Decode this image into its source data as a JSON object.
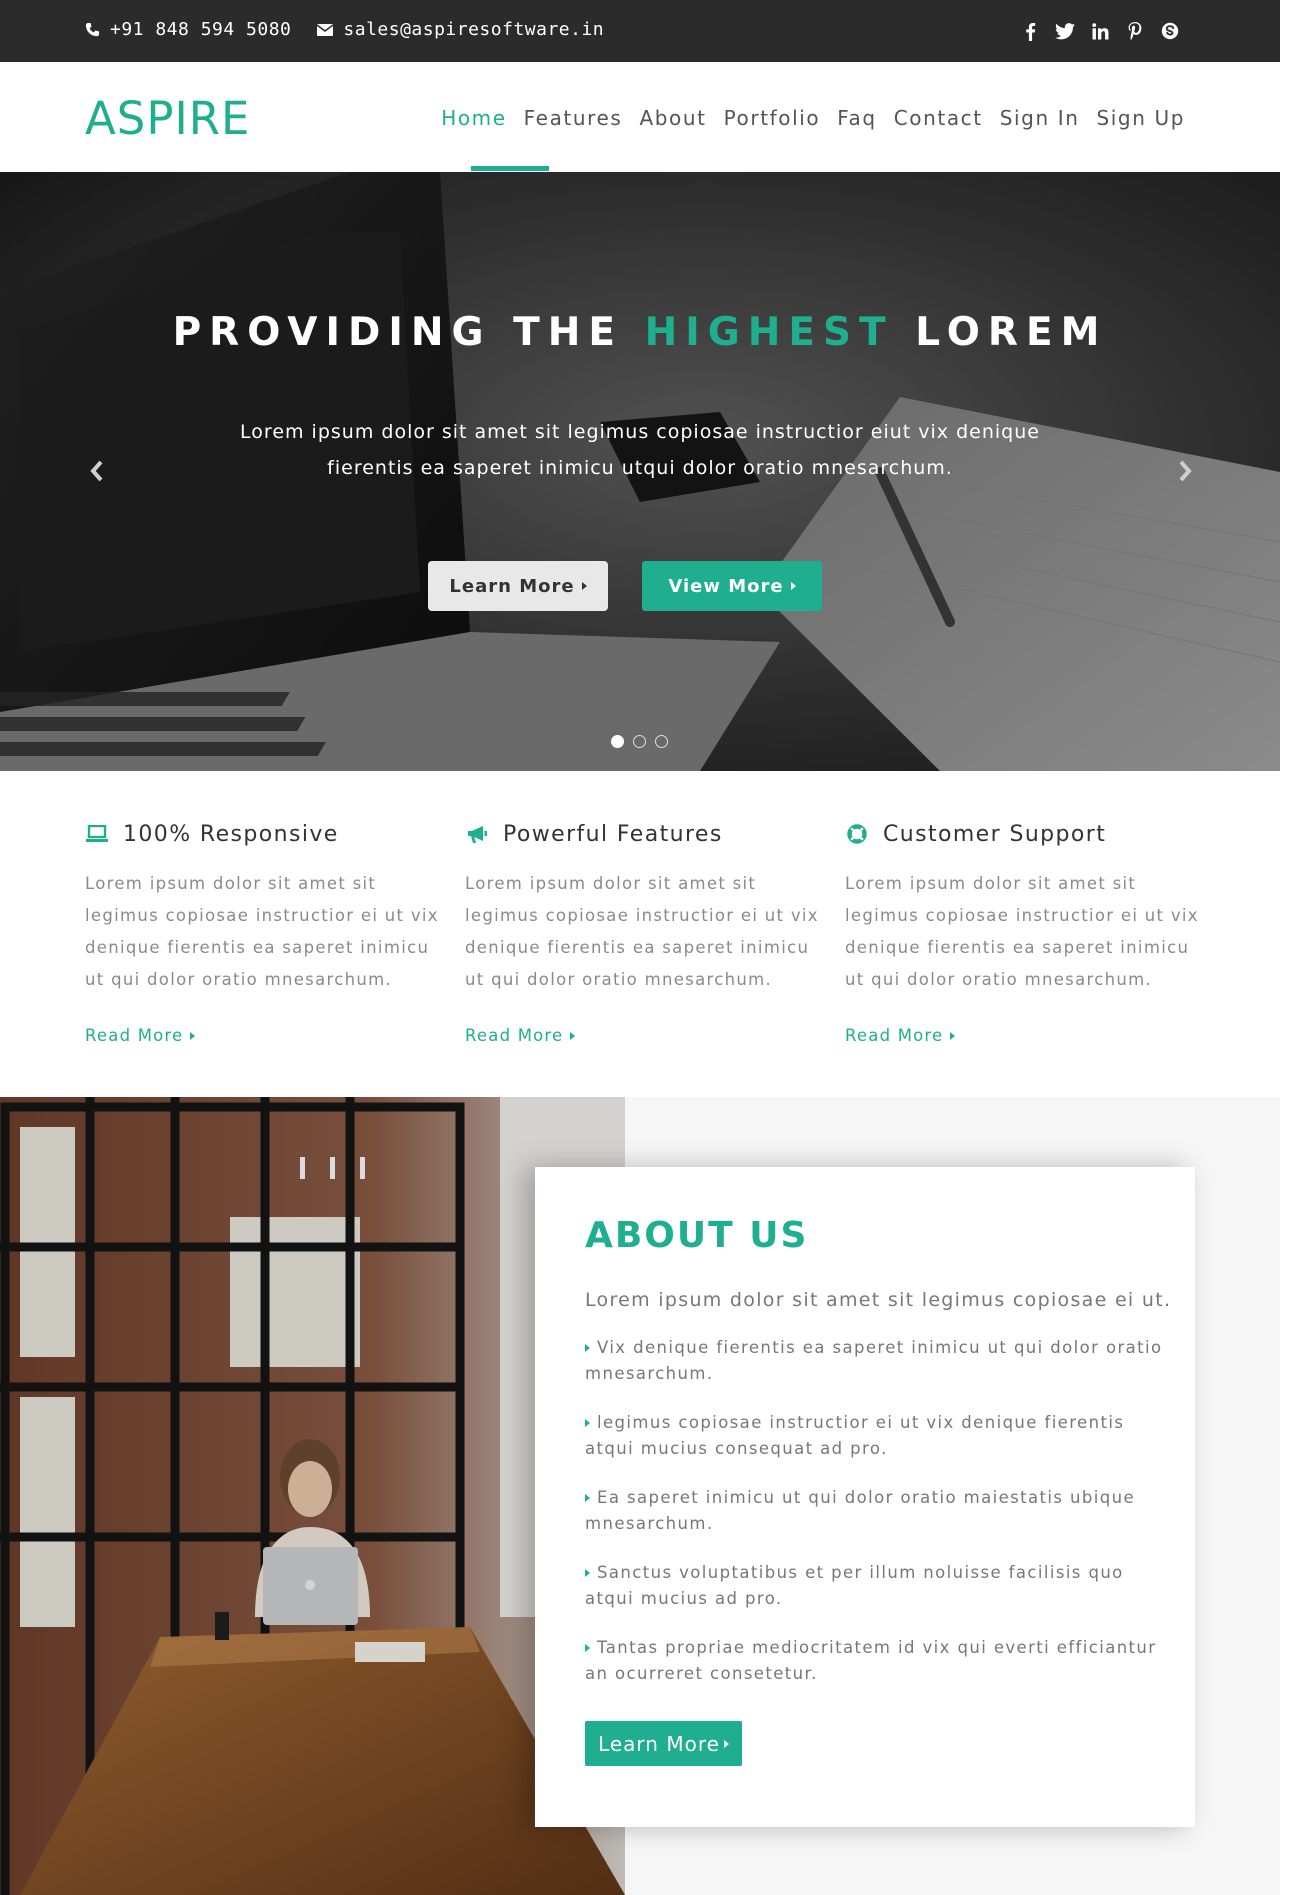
{
  "topbar": {
    "phone": "+91 848 594 5080",
    "email": "sales@aspiresoftware.in",
    "social": [
      "facebook-icon",
      "twitter-icon",
      "linkedin-icon",
      "pinterest-icon",
      "skype-icon"
    ]
  },
  "nav": {
    "logo": "ASPIRE",
    "items": [
      "Home",
      "Features",
      "About",
      "Portfolio",
      "Faq",
      "Contact",
      "Sign In",
      "Sign Up"
    ],
    "active": "Home"
  },
  "hero": {
    "title_pre": "PROVIDING THE",
    "title_highlight": "HIGHEST",
    "title_post": "LOREM",
    "subtitle": "Lorem ipsum dolor sit amet sit legimus copiosae instructior eiut vix denique fierentis ea saperet inimicu utqui dolor oratio mnesarchum.",
    "btn_learn": "Learn More",
    "btn_view": "View More",
    "slides": 3,
    "active_slide": 1
  },
  "features": [
    {
      "icon": "laptop-icon",
      "title": "100% Responsive",
      "text": "Lorem ipsum dolor sit amet sit legimus copiosae instructior ei ut vix denique fierentis ea saperet inimicu ut qui dolor oratio mnesarchum.",
      "link": "Read More"
    },
    {
      "icon": "megaphone-icon",
      "title": "Powerful Features",
      "text": "Lorem ipsum dolor sit amet sit legimus copiosae instructior ei ut vix denique fierentis ea saperet inimicu ut qui dolor oratio mnesarchum.",
      "link": "Read More"
    },
    {
      "icon": "lifebuoy-icon",
      "title": "Customer Support",
      "text": "Lorem ipsum dolor sit amet sit legimus copiosae instructior ei ut vix denique fierentis ea saperet inimicu ut qui dolor oratio mnesarchum.",
      "link": "Read More"
    }
  ],
  "about": {
    "title": "ABOUT US",
    "lead": "Lorem ipsum dolor sit amet sit legimus copiosae ei ut.",
    "points": [
      "Vix denique fierentis ea saperet inimicu ut qui dolor oratio mnesarchum.",
      "legimus copiosae instructior ei ut vix denique fierentis atqui mucius consequat ad pro.",
      "Ea saperet inimicu ut qui dolor oratio maiestatis ubique mnesarchum.",
      "Sanctus voluptatibus et per illum noluisse facilisis quo atqui mucius ad pro.",
      "Tantas propriae mediocritatem id vix qui everti efficiantur an ocurreret consetetur."
    ],
    "button": "Learn More"
  },
  "colors": {
    "accent": "#1fae8f",
    "topbar": "#2b2b2b",
    "text": "#555555",
    "muted": "#8a8a8a"
  }
}
